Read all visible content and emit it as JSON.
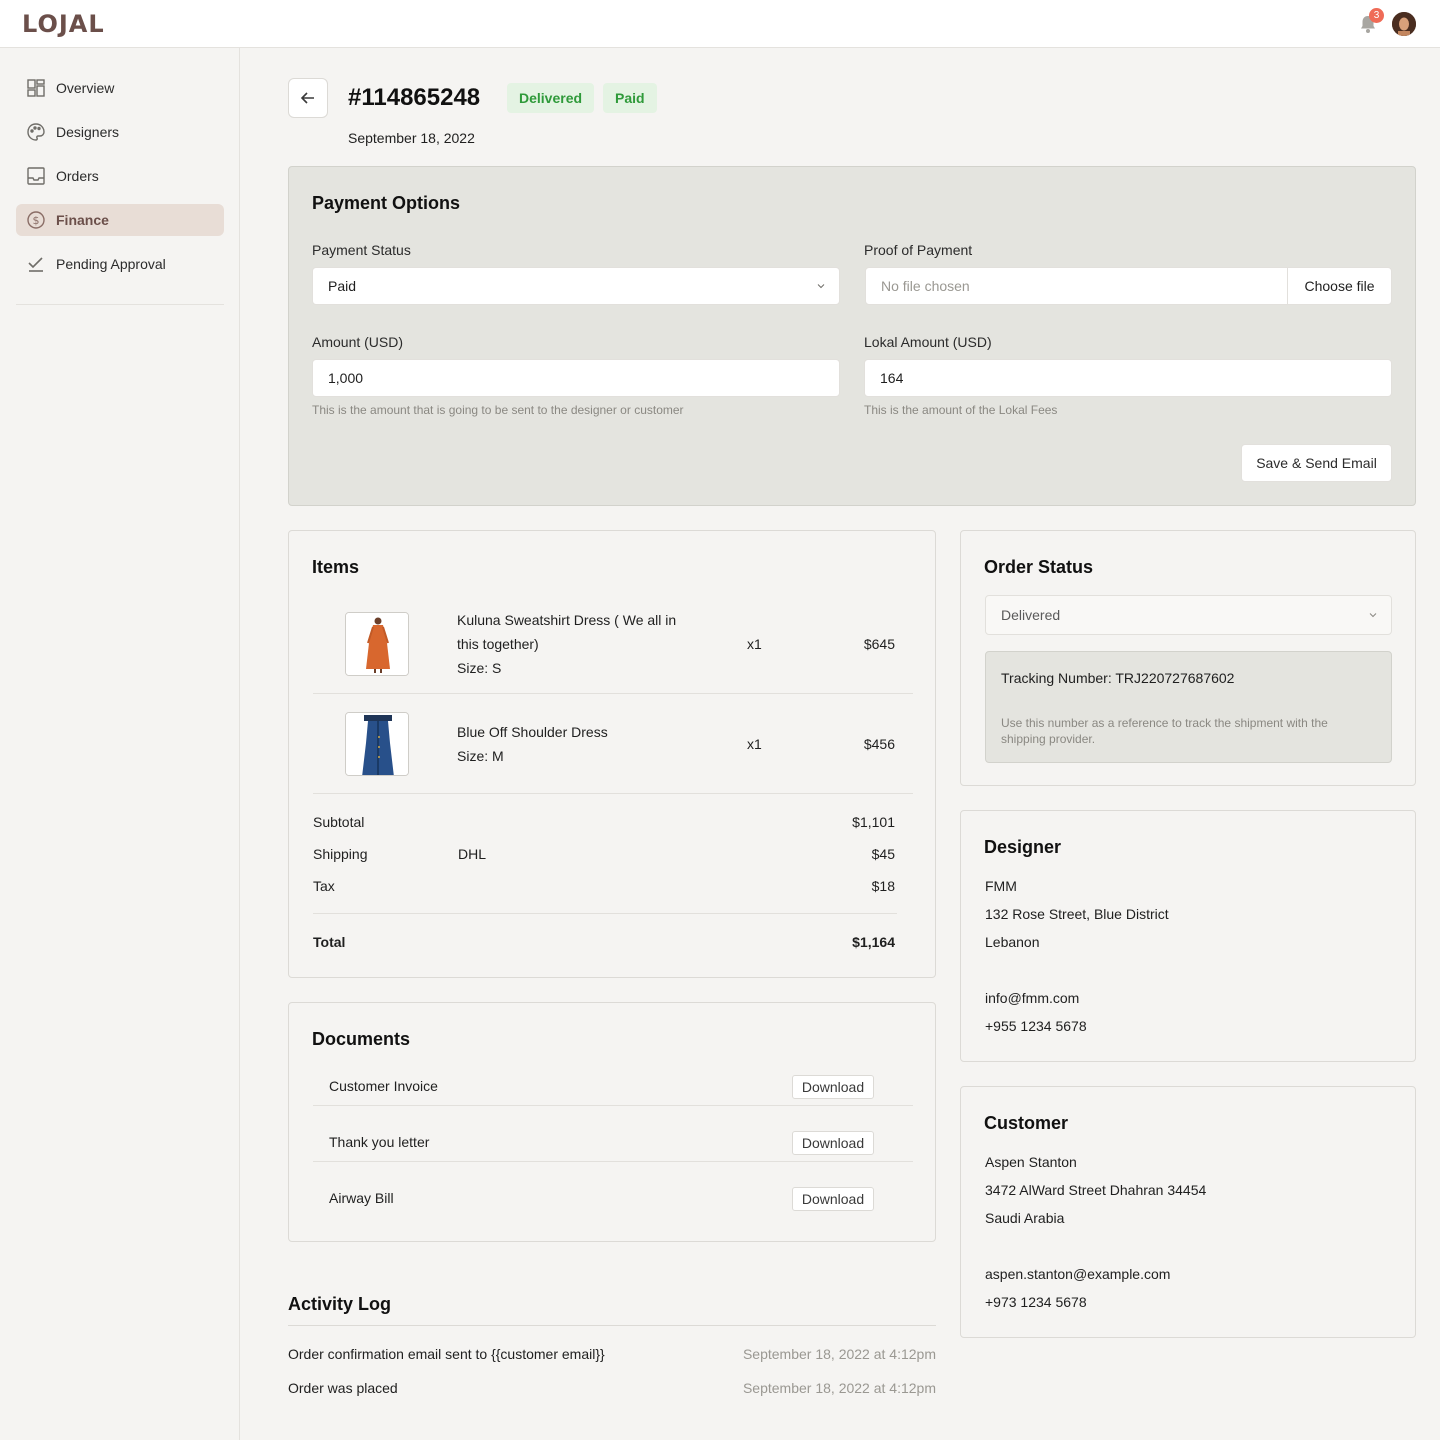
{
  "app": {
    "logo": "LOJAL",
    "notifications": "3"
  },
  "sidebar": {
    "items": [
      {
        "label": "Overview",
        "icon": "grid-icon"
      },
      {
        "label": "Designers",
        "icon": "palette-icon"
      },
      {
        "label": "Orders",
        "icon": "inbox-icon"
      },
      {
        "label": "Finance",
        "icon": "dollar-icon",
        "active": true
      },
      {
        "label": "Pending Approval",
        "icon": "check-icon"
      }
    ]
  },
  "order": {
    "id": "#114865248",
    "status_badge": "Delivered",
    "payment_badge": "Paid",
    "date": "September 18, 2022"
  },
  "payment": {
    "title": "Payment Options",
    "status_label": "Payment Status",
    "status_value": "Paid",
    "proof_label": "Proof of Payment",
    "proof_placeholder": "No file chosen",
    "proof_button": "Choose file",
    "amount_label": "Amount (USD)",
    "amount_value": "1,000",
    "amount_help": "This is the amount that is going to be sent to the designer or customer",
    "lokal_label": "Lokal Amount (USD)",
    "lokal_value": "164",
    "lokal_help": "This is the amount of the Lokal Fees",
    "save_button": "Save & Send Email"
  },
  "items": {
    "title": "Items",
    "list": [
      {
        "name": "Kuluna Sweatshirt Dress ( We all in this together)",
        "size": "Size: S",
        "qty": "x1",
        "price": "$645"
      },
      {
        "name": "Blue Off Shoulder Dress",
        "size": "Size: M",
        "qty": "x1",
        "price": "$456"
      }
    ],
    "subtotal_label": "Subtotal",
    "subtotal": "$1,101",
    "shipping_label": "Shipping",
    "shipping_carrier": "DHL",
    "shipping": "$45",
    "tax_label": "Tax",
    "tax": "$18",
    "total_label": "Total",
    "total": "$1,164"
  },
  "documents": {
    "title": "Documents",
    "list": [
      {
        "label": "Customer Invoice",
        "button": "Download"
      },
      {
        "label": "Thank you letter",
        "button": "Download"
      },
      {
        "label": "Airway Bill",
        "button": "Download"
      }
    ]
  },
  "activity": {
    "title": "Activity Log",
    "entries": [
      {
        "text": "Order confirmation email sent to {{customer email}}",
        "time": "September 18, 2022 at 4:12pm"
      },
      {
        "text": "Order was placed",
        "time": "September 18, 2022 at 4:12pm"
      }
    ]
  },
  "order_status": {
    "title": "Order Status",
    "value": "Delivered",
    "tracking": "Tracking Number: TRJ220727687602",
    "tracking_help": "Use this number as a reference to track the shipment with the shipping provider."
  },
  "designer": {
    "title": "Designer",
    "name": "FMM",
    "address": "132 Rose Street, Blue District",
    "country": "Lebanon",
    "email": "info@fmm.com",
    "phone": "+955 1234 5678"
  },
  "customer": {
    "title": "Customer",
    "name": "Aspen Stanton",
    "address": "3472 AlWard Street Dhahran 34454",
    "country": "Saudi Arabia",
    "email": "aspen.stanton@example.com",
    "phone": "+973 1234 5678"
  },
  "colors": {
    "brand": "#6b4f4a",
    "success": "#2f9a3a",
    "success_bg": "#e4f3e3",
    "notif": "#ef6b57"
  }
}
